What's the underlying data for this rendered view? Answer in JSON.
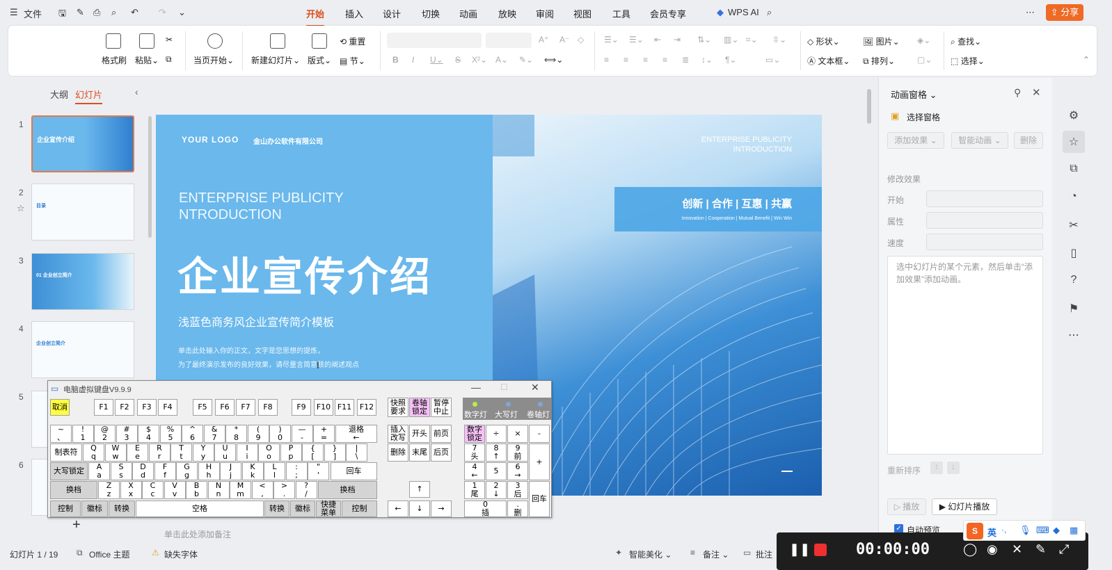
{
  "titlebar": {
    "file_menu": "文件",
    "tabs": [
      "开始",
      "插入",
      "设计",
      "切换",
      "动画",
      "放映",
      "审阅",
      "视图",
      "工具",
      "会员专享"
    ],
    "wps_ai": "WPS AI",
    "share": "分享"
  },
  "ribbon": {
    "format_painter": "格式刷",
    "paste": "粘贴",
    "play_from_current": "当页开始",
    "new_slide": "新建幻灯片",
    "layout": "版式",
    "reset": "重置",
    "section": "节",
    "shape": "形状",
    "picture": "图片",
    "textbox": "文本框",
    "arrange": "排列",
    "find": "查找",
    "select": "选择"
  },
  "leftpanel": {
    "outline_tab": "大纲",
    "slides_tab": "幻灯片",
    "thumbnails": [
      {
        "num": "1",
        "title": "企业宣传介绍"
      },
      {
        "num": "2",
        "title": "目录"
      },
      {
        "num": "3",
        "title": "01 企业创立简介"
      },
      {
        "num": "4",
        "title": "企业创立简介"
      },
      {
        "num": "5",
        "title": ""
      },
      {
        "num": "6",
        "title": ""
      }
    ]
  },
  "slide": {
    "logo": "YOUR  LOGO",
    "company": "金山办公软件有限公司",
    "en_title_line1": "ENTERPRISE PUBLICITY",
    "en_title_line2": "NTRODUCTION",
    "cn_title": "企业宣传介绍",
    "subtitle": "浅蓝色商务风企业宣传简介模板",
    "body_line1": "单击此处输入你的正文，文字是您思想的提炼，",
    "body_line2": "为了最终演示发布的良好效果，请尽量言简意赅的阐述观点",
    "right_en_line1": "ENTERPRISE PUBLICITY",
    "right_en_line2": "INTRODUCTION",
    "slogan": "创新 | 合作 | 互惠 | 共赢",
    "slogan_en": "Innovation | Cooperation | Mutual Benefit | Win Win"
  },
  "notes_placeholder": "单击此处添加备注",
  "rightpanel": {
    "title": "动画窗格",
    "select_pane": "选择窗格",
    "add_effect": "添加效果",
    "smart_anim": "智能动画",
    "delete": "删除",
    "modify_effect": "修改效果",
    "start_label": "开始",
    "property_label": "属性",
    "speed_label": "速度",
    "hint": "选中幻灯片的某个元素，然后单击“添加效果”添加动画。",
    "reorder": "重新排序",
    "play": "播放",
    "slideshow": "幻灯片播放",
    "auto_preview": "自动预览"
  },
  "statusbar": {
    "slide_count": "幻灯片 1 / 19",
    "theme": "Office 主题",
    "missing_font": "缺失字体",
    "smart_beautify": "智能美化",
    "notes": "备注",
    "comments": "批注"
  },
  "vkb": {
    "title": "电脑虚拟键盘V9.9.9",
    "cancel": "取消",
    "fkeys": [
      "F1",
      "F2",
      "F3",
      "F4",
      "F5",
      "F6",
      "F7",
      "F8",
      "F9",
      "F10",
      "F11",
      "F12"
    ],
    "print_screen": "快照\n要求",
    "scroll_lock": "卷轴\n锁定",
    "pause": "暂停\n中止",
    "num_led": "数字灯",
    "caps_led": "大写灯",
    "scroll_led": "卷轴灯",
    "row1": [
      [
        "~",
        "、"
      ],
      [
        "!",
        "1"
      ],
      [
        "@",
        "2"
      ],
      [
        "#",
        "3"
      ],
      [
        "$",
        "4"
      ],
      [
        "%",
        "5"
      ],
      [
        "^",
        "6"
      ],
      [
        "&",
        "7"
      ],
      [
        "*",
        "8"
      ],
      [
        "(",
        "9"
      ],
      [
        ")",
        "0"
      ],
      [
        "—",
        "-"
      ],
      [
        "+",
        "="
      ]
    ],
    "backspace": "退格",
    "backspace_sub": "←",
    "tab": "制表符",
    "row2": [
      [
        "Q",
        "q"
      ],
      [
        "W",
        "w"
      ],
      [
        "E",
        "e"
      ],
      [
        "R",
        "r"
      ],
      [
        "T",
        "t"
      ],
      [
        "Y",
        "y"
      ],
      [
        "U",
        "u"
      ],
      [
        "I",
        "i"
      ],
      [
        "O",
        "o"
      ],
      [
        "P",
        "p"
      ],
      [
        "{",
        "["
      ],
      [
        "}",
        "]"
      ],
      [
        "|",
        "\\"
      ]
    ],
    "caps": "大写锁定",
    "row3": [
      [
        "A",
        "a"
      ],
      [
        "S",
        "s"
      ],
      [
        "D",
        "d"
      ],
      [
        "F",
        "f"
      ],
      [
        "G",
        "g"
      ],
      [
        "H",
        "h"
      ],
      [
        "J",
        "j"
      ],
      [
        "K",
        "k"
      ],
      [
        "L",
        "l"
      ],
      [
        ":",
        ";"
      ],
      [
        "\"",
        "'"
      ]
    ],
    "enter": "回车",
    "shift": "换档",
    "row4": [
      [
        "Z",
        "z"
      ],
      [
        "X",
        "x"
      ],
      [
        "C",
        "c"
      ],
      [
        "V",
        "v"
      ],
      [
        "B",
        "b"
      ],
      [
        "N",
        "n"
      ],
      [
        "M",
        "m"
      ],
      [
        "<",
        ","
      ],
      [
        ">",
        "."
      ],
      [
        "?",
        "/"
      ]
    ],
    "ctrl": "控制",
    "win": "徽标",
    "alt": "转换",
    "space": "空格",
    "menu": "快捷\n菜单",
    "insert": "插入\n改写",
    "home": "开头",
    "pageup": "前页",
    "delete": "删除",
    "end": "末尾",
    "pagedown": "后页",
    "numlock": "数字\n锁定",
    "num_div": "÷",
    "num_mul": "×",
    "num_sub": "-",
    "num_add": "+",
    "num7": [
      "7",
      "头"
    ],
    "num8": [
      "8",
      "↑"
    ],
    "num9": [
      "9",
      "前"
    ],
    "num4": [
      "4",
      "←"
    ],
    "num5": [
      "5",
      ""
    ],
    "num6": [
      "6",
      "→"
    ],
    "num1": [
      "1",
      "尾"
    ],
    "num2": [
      "2",
      "↓"
    ],
    "num3": [
      "3",
      "后"
    ],
    "num0": [
      "0",
      "插"
    ],
    "numdot": [
      ".",
      "删"
    ],
    "num_enter": "回车",
    "arrow_up": "↑",
    "arrow_left": "←",
    "arrow_down": "↓",
    "arrow_right": "→"
  },
  "recorder": {
    "time": "00:00:00",
    "ime_lang": "英"
  }
}
